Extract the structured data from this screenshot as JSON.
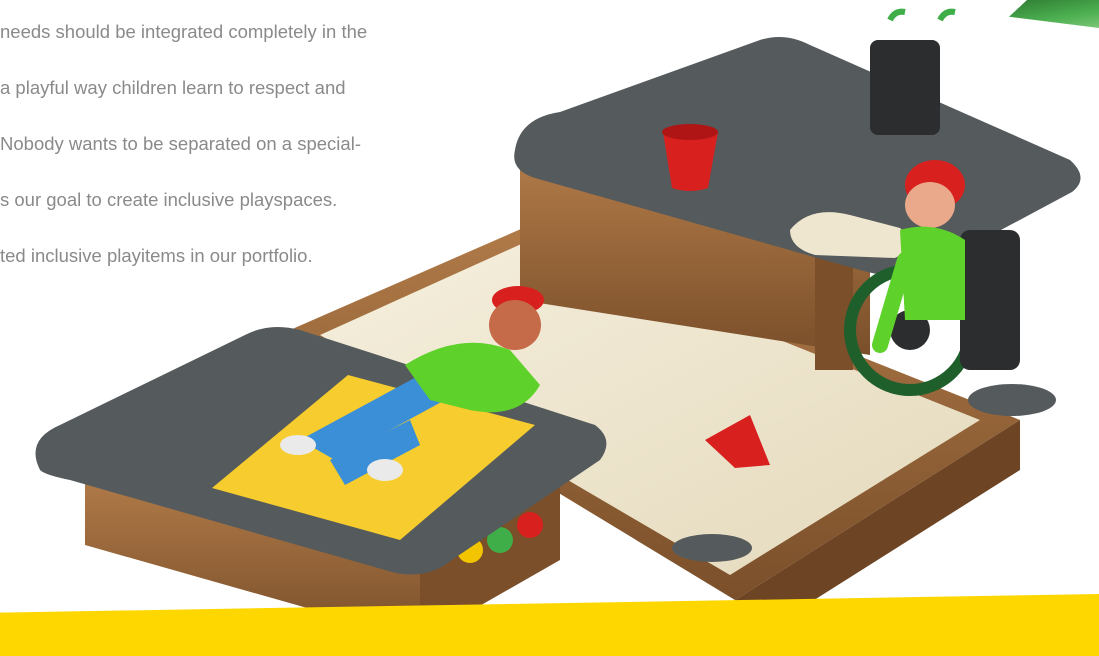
{
  "intro": {
    "lines": [
      "needs should be integrated completely in the",
      "a playful way children learn to respect and",
      "Nobody wants to be separated on a special-",
      "s our goal to create inclusive playspaces.",
      "ted inclusive playitems in our portfolio."
    ],
    "color": "#8a8a8a"
  },
  "illustration": {
    "objects": [
      "sandbox",
      "raised-table",
      "low-platform",
      "yellow-mat",
      "red-bucket",
      "red-shovel",
      "child-lying",
      "child-wheelchair",
      "wheelchair",
      "round-stool"
    ]
  },
  "colors": {
    "accent_yellow": "#ffd700",
    "table_top": "#555a5c",
    "wood": "#9c6a3e",
    "sand": "#efe6cf",
    "shirt_green": "#5fd12b",
    "jeans_blue": "#3a8fd6",
    "bucket_red": "#d8201f"
  }
}
